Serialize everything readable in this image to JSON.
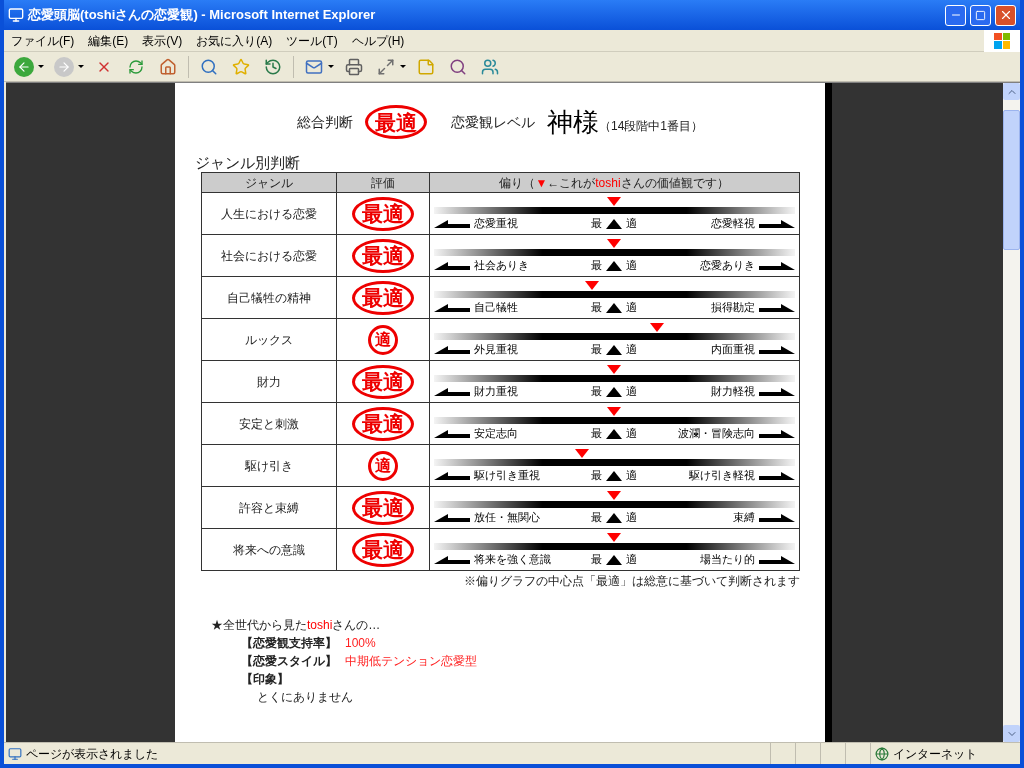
{
  "window": {
    "title": "恋愛頭脳(toshiさんの恋愛観) - Microsoft Internet Explorer"
  },
  "menu": [
    "ファイル(F)",
    "編集(E)",
    "表示(V)",
    "お気に入り(A)",
    "ツール(T)",
    "ヘルプ(H)"
  ],
  "nav_buttons": [
    {
      "disabled": false
    },
    {
      "disabled": true
    }
  ],
  "overall": {
    "label": "総合判断",
    "stamp": {
      "kind": "oval",
      "text": "最適"
    },
    "rank_label": "恋愛観レベル",
    "rank": "神様",
    "rank_note": "（14段階中1番目）"
  },
  "section_title": "ジャンル別判断",
  "table": {
    "columns": [
      {
        "parts": [
          {
            "text": "ジャンル",
            "accent": false
          }
        ]
      },
      {
        "parts": [
          {
            "text": "評価",
            "accent": false
          }
        ]
      },
      {
        "parts": [
          {
            "text": "偏り（",
            "accent": false
          },
          {
            "text": "▼",
            "accent": true
          },
          {
            "text": "←これが",
            "accent": false
          },
          {
            "text": "toshi",
            "accent": true
          },
          {
            "text": "さんの価値観です）",
            "accent": false
          }
        ]
      }
    ],
    "rows": [
      {
        "genre": "人生における恋愛",
        "stamp": {
          "kind": "oval",
          "text": "最適"
        },
        "bias": {
          "level": 0.5,
          "left": "恋愛重視",
          "mid_left": "最",
          "mid_right": "適",
          "right": "恋愛軽視"
        }
      },
      {
        "genre": "社会における恋愛",
        "stamp": {
          "kind": "oval",
          "text": "最適"
        },
        "bias": {
          "level": 0.5,
          "left": "社会ありき",
          "mid_left": "最",
          "mid_right": "適",
          "right": "恋愛ありき"
        }
      },
      {
        "genre": "自己犠牲の精神",
        "stamp": {
          "kind": "oval",
          "text": "最適"
        },
        "bias": {
          "level": 0.44,
          "left": "自己犠牲",
          "mid_left": "最",
          "mid_right": "適",
          "right": "損得勘定"
        }
      },
      {
        "genre": "ルックス",
        "stamp": {
          "kind": "circle",
          "text": "適"
        },
        "bias": {
          "level": 0.62,
          "left": "外見重視",
          "mid_left": "最",
          "mid_right": "適",
          "right": "内面重視"
        }
      },
      {
        "genre": "財力",
        "stamp": {
          "kind": "oval",
          "text": "最適"
        },
        "bias": {
          "level": 0.5,
          "left": "財力重視",
          "mid_left": "最",
          "mid_right": "適",
          "right": "財力軽視"
        }
      },
      {
        "genre": "安定と刺激",
        "stamp": {
          "kind": "oval",
          "text": "最適"
        },
        "bias": {
          "level": 0.5,
          "left": "安定志向",
          "mid_left": "最",
          "mid_right": "適",
          "right": "波瀾・冒険志向"
        }
      },
      {
        "genre": "駆け引き",
        "stamp": {
          "kind": "circle",
          "text": "適"
        },
        "bias": {
          "level": 0.41,
          "left": "駆け引き重視",
          "mid_left": "最",
          "mid_right": "適",
          "right": "駆け引き軽視"
        }
      },
      {
        "genre": "許容と束縛",
        "stamp": {
          "kind": "oval",
          "text": "最適"
        },
        "bias": {
          "level": 0.5,
          "left": "放任・無関心",
          "mid_left": "最",
          "mid_right": "適",
          "right": "束縛"
        }
      },
      {
        "genre": "将来への意識",
        "stamp": {
          "kind": "oval",
          "text": "最適"
        },
        "bias": {
          "level": 0.5,
          "left": "将来を強く意識",
          "mid_left": "最",
          "mid_right": "適",
          "right": "場当たり的"
        }
      }
    ]
  },
  "footnote": "※偏りグラフの中心点「最適」は総意に基づいて判断されます",
  "evaluation": {
    "intro": [
      {
        "text": "★全世代から見た",
        "accent": false
      },
      {
        "text": "toshi",
        "accent": true
      },
      {
        "text": "さんの…",
        "accent": false
      }
    ],
    "items": [
      {
        "label": "【恋愛観支持率】",
        "value": "100%"
      },
      {
        "label": "【恋愛スタイル】",
        "value": "中期低テンション恋愛型"
      }
    ],
    "impression": {
      "label": "【印象】",
      "text": "とくにありません"
    }
  },
  "status_bar": {
    "text": "ページが表示されました",
    "zone": "インターネット"
  }
}
